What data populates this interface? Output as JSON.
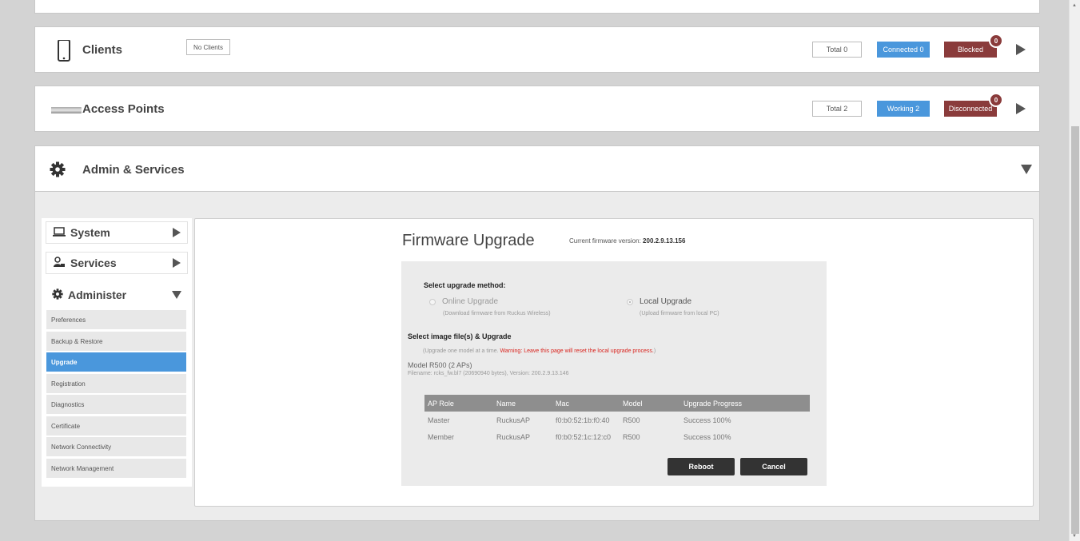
{
  "clients": {
    "title": "Clients",
    "icon": "mobile-phone-icon",
    "no_clients": "No Clients",
    "total": "Total 0",
    "connected": "Connected 0",
    "blocked": "Blocked",
    "blocked_badge": "0"
  },
  "access_points": {
    "title": "Access Points",
    "icon": "access-point-device-icon",
    "total": "Total 2",
    "working": "Working 2",
    "disconnected": "Disconnected",
    "disconnected_badge": "0"
  },
  "admin": {
    "title": "Admin & Services",
    "icon": "gear-icon"
  },
  "sidebar": {
    "sections": [
      {
        "label": "System",
        "icon": "laptop-icon"
      },
      {
        "label": "Services",
        "icon": "services-icon"
      },
      {
        "label": "Administer",
        "icon": "gear-icon"
      }
    ],
    "items": [
      {
        "label": "Preferences"
      },
      {
        "label": "Backup & Restore"
      },
      {
        "label": "Upgrade",
        "active": true
      },
      {
        "label": "Registration"
      },
      {
        "label": "Diagnostics"
      },
      {
        "label": "Certificate"
      },
      {
        "label": "Network Connectivity"
      },
      {
        "label": "Network Management"
      }
    ]
  },
  "firmware": {
    "title": "Firmware Upgrade",
    "current_label": "Current firmware version:",
    "current_version": "200.2.9.13.156",
    "select_method_heading": "Select upgrade method:",
    "online_label": "Online Upgrade",
    "online_sub": "(Download firmware from Ruckus Wireless)",
    "local_label": "Local Upgrade",
    "local_sub": "(Upload firmware from local PC)",
    "select_image_heading": "Select image file(s) & Upgrade",
    "note_prefix": "(Upgrade one model at a time.",
    "note_warning": "Warning: Leave this page will reset the local upgrade process.",
    "note_suffix": ")",
    "model_title": "Model R500 (2 APs)",
    "model_file": "Filename: rcks_fw.bl7 (20690940 bytes), Version: 200.2.9.13.146",
    "table": {
      "headers": [
        "AP Role",
        "Name",
        "Mac",
        "Model",
        "Upgrade Progress"
      ],
      "rows": [
        [
          "Master",
          "RuckusAP",
          "f0:b0:52:1b:f0:40",
          "R500",
          "Success 100%"
        ],
        [
          "Member",
          "RuckusAP",
          "f0:b0:52:1c:12:c0",
          "R500",
          "Success 100%"
        ]
      ]
    },
    "reboot_label": "Reboot",
    "cancel_label": "Cancel"
  },
  "colors": {
    "accent_blue": "#4a97dc",
    "alert_red": "#8a3b3b",
    "warning_text": "#d9231d"
  }
}
